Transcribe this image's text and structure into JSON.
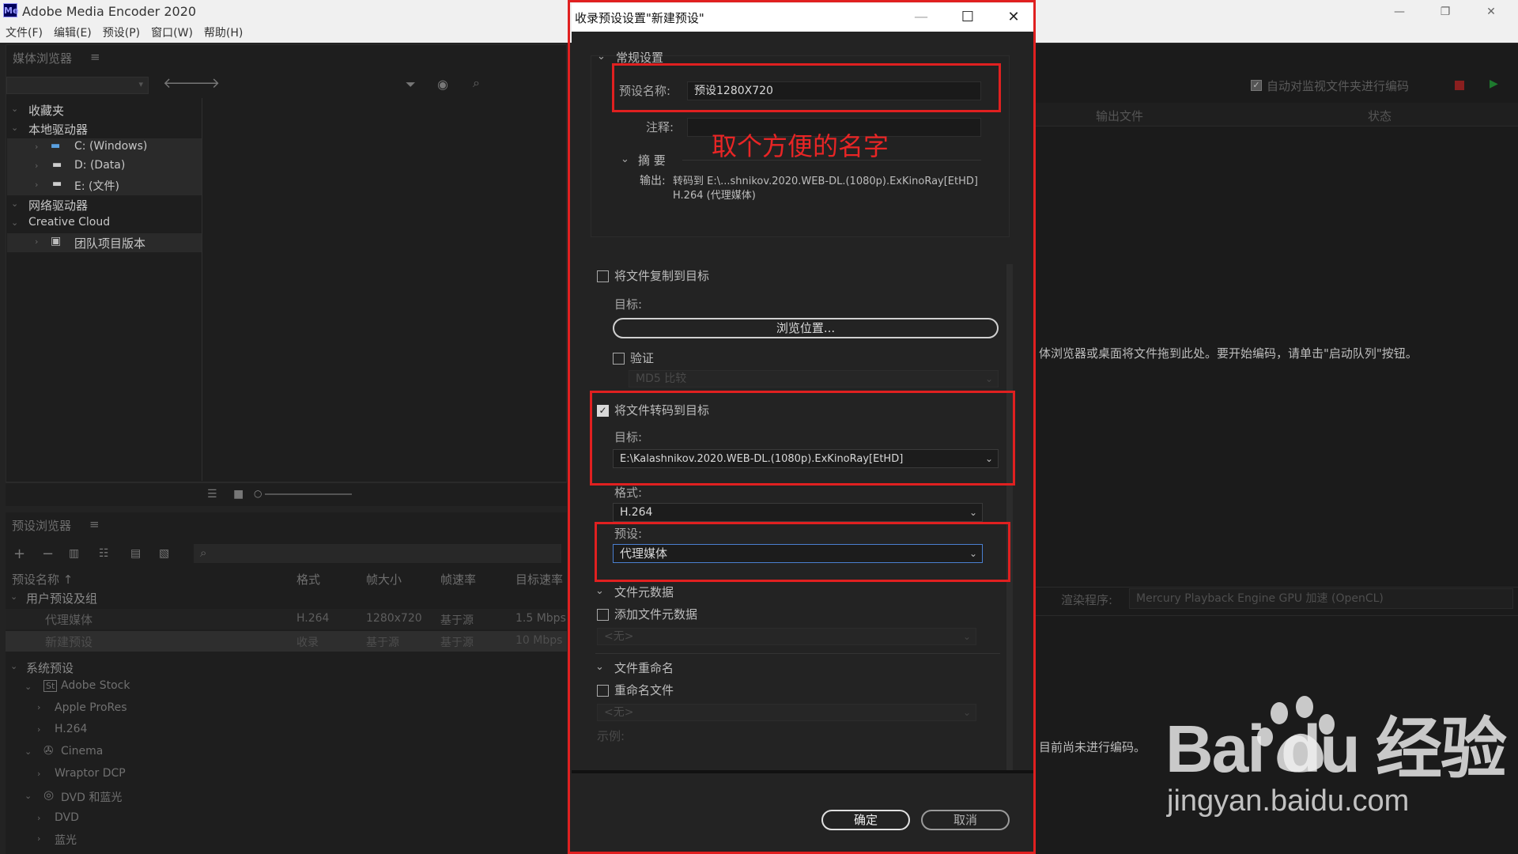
{
  "app": {
    "title": "Adobe Media Encoder 2020",
    "icon_glyph": "Me",
    "window_controls": [
      "—",
      "❐",
      "✕"
    ]
  },
  "menu": [
    "文件(F)",
    "编辑(E)",
    "预设(P)",
    "窗口(W)",
    "帮助(H)"
  ],
  "media_browser": {
    "title": "媒体浏览器",
    "menu_glyph": "≡",
    "tree": {
      "favorites": "收藏夹",
      "local_drives": "本地驱动器",
      "drive_c": "C: (Windows)",
      "drive_d": "D: (Data)",
      "drive_e": "E: (文件)",
      "network_drives": "网络驱动器",
      "creative_cloud": "Creative Cloud",
      "team_projects": "团队项目版本"
    }
  },
  "preset_browser": {
    "title": "预设浏览器",
    "columns": [
      "预设名称 ↑",
      "格式",
      "帧大小",
      "帧速率",
      "目标速率"
    ],
    "user_group": "用户预设及组",
    "user_presets": [
      {
        "name": "代理媒体",
        "format": "H.264",
        "frame": "1280x720",
        "rate": "基于源",
        "target": "1.5 Mbps"
      },
      {
        "name": "新建预设",
        "format": "收录",
        "frame": "基于源",
        "rate": "基于源",
        "target": "10 Mbps"
      }
    ],
    "system_group": "系统预设",
    "system_items": [
      "Adobe Stock",
      "Apple ProRes",
      "H.264",
      "Cinema",
      "Wraptor DCP",
      "DVD 和蓝光",
      "DVD",
      "蓝光"
    ]
  },
  "queue": {
    "auto_encode_label": "自动对监视文件夹进行编码",
    "col_output": "输出文件",
    "col_status": "状态",
    "drop_hint": "体浏览器或桌面将文件拖到此处。要开始编码，请单击\"启动队列\"按钮。",
    "renderer_label": "渲染程序:",
    "renderer_value": "Mercury Playback Engine GPU 加速 (OpenCL)",
    "not_encoding": "目前尚未进行编码。"
  },
  "dialog": {
    "title": "收录预设设置\"新建预设\"",
    "controls": [
      "—",
      "☐",
      "✕"
    ],
    "general_section": "常规设置",
    "preset_name_label": "预设名称:",
    "preset_name_value": "预设1280X720",
    "comment_label": "注释:",
    "comment_value": "",
    "summary_label": "摘 要",
    "summary_output_label": "输出:",
    "summary_line1": "转码到  E:\\...shnikov.2020.WEB-DL.(1080p).ExKinoRay[EtHD]",
    "summary_line2": "H.264 (代理媒体)",
    "copy_files_label": "将文件复制到目标",
    "copy_files_checked": false,
    "copy_target_label": "目标:",
    "browse_button": "浏览位置...",
    "verify_label": "验证",
    "verify_checked": false,
    "verify_method": "MD5 比较",
    "transcode_label": "将文件转码到目标",
    "transcode_checked": true,
    "transcode_target_label": "目标:",
    "transcode_target_value": "E:\\Kalashnikov.2020.WEB-DL.(1080p).ExKinoRay[EtHD]",
    "format_label": "格式:",
    "format_value": "H.264",
    "preset_label": "预设:",
    "preset_value": "代理媒体",
    "metadata_section": "文件元数据",
    "add_metadata_label": "添加文件元数据",
    "add_metadata_checked": false,
    "metadata_value": "<无>",
    "rename_section": "文件重命名",
    "rename_label": "重命名文件",
    "rename_checked": false,
    "rename_value": "<无>",
    "example_label": "示例:",
    "ok_button": "确定",
    "cancel_button": "取消"
  },
  "annotation_text": "取个方便的名字",
  "watermark": {
    "main": "Bai du 经验",
    "sub": "jingyan.baidu.com"
  }
}
